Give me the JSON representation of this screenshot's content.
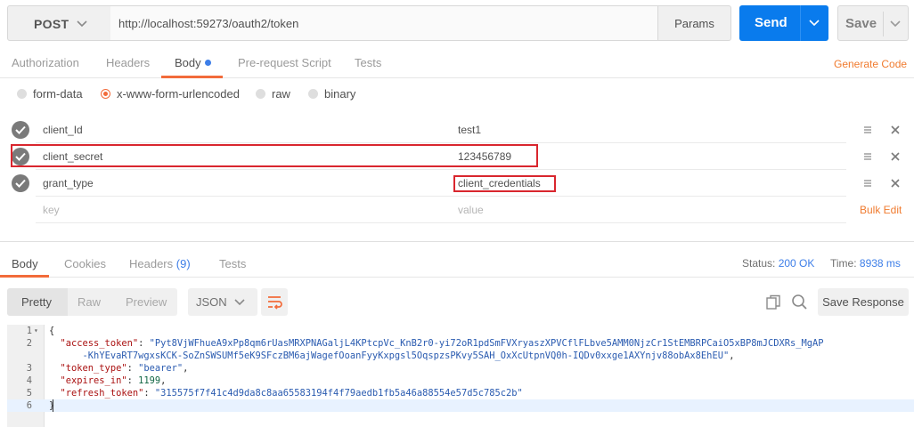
{
  "request": {
    "method": "POST",
    "url": "http://localhost:59273/oauth2/token",
    "params_label": "Params",
    "send_label": "Send",
    "save_label": "Save"
  },
  "request_tabs": [
    {
      "label": "Authorization",
      "active": false
    },
    {
      "label": "Headers",
      "active": false
    },
    {
      "label": "Body",
      "active": true
    },
    {
      "label": "Pre-request Script",
      "active": false
    },
    {
      "label": "Tests",
      "active": false
    }
  ],
  "generate_code_label": "Generate Code",
  "body_types": [
    {
      "label": "form-data",
      "selected": false
    },
    {
      "label": "x-www-form-urlencoded",
      "selected": true
    },
    {
      "label": "raw",
      "selected": false
    },
    {
      "label": "binary",
      "selected": false
    }
  ],
  "params": [
    {
      "key": "client_Id",
      "value": "test1",
      "enabled": true
    },
    {
      "key": "client_secret",
      "value": "123456789",
      "enabled": true
    },
    {
      "key": "grant_type",
      "value": "client_credentials",
      "enabled": true
    }
  ],
  "new_row": {
    "key_placeholder": "key",
    "value_placeholder": "value"
  },
  "bulk_edit_label": "Bulk Edit",
  "response_tabs": [
    {
      "label": "Body",
      "active": true
    },
    {
      "label": "Cookies",
      "active": false
    },
    {
      "label": "Headers",
      "count": "(9)",
      "active": false
    },
    {
      "label": "Tests",
      "active": false
    }
  ],
  "status": {
    "label": "Status:",
    "value": "200 OK",
    "time_label": "Time:",
    "time_value": "8938 ms"
  },
  "view_modes": [
    "Pretty",
    "Raw",
    "Preview"
  ],
  "format": "JSON",
  "save_response_label": "Save Response",
  "response_body": {
    "line_numbers": [
      "1",
      "2",
      "3",
      "4",
      "5",
      "6"
    ],
    "open_brace": "{",
    "close_brace": "}",
    "access_token_key": "\"access_token\"",
    "access_token_value_part1": "\"Pyt8VjWFhueA9xPp8qm6rUasMRXPNAGaljL4KPtcpVc_KnB2r0-yi72oR1pdSmFVXryaszXPVCflFLbve5AMM0NjzCr1StEMBRPCaiO5xBP8mJCDXRs_MgAP",
    "access_token_value_part2": "-KhYEvaRT7wgxsKCK-SoZnSWSUMf5eK9SFczBM6ajWagefOoanFyyKxpgsl5OqspzsPKvy5SAH_OxXcUtpnVQ0h-IQDv0xxge1AXYnjv88obAx8EhEU\"",
    "token_type_key": "\"token_type\"",
    "token_type_value": "\"bearer\"",
    "expires_in_key": "\"expires_in\"",
    "expires_in_value": "1199",
    "refresh_token_key": "\"refresh_token\"",
    "refresh_token_value": "\"315575f7f41c4d9da8c8aa65583194f4f79aedb1fb5a46a88554e57d5c785c2b\""
  },
  "colors": {
    "send_button": "#097bed",
    "accent_orange": "#f26b3a",
    "link_orange": "#f07b2f",
    "highlight_box": "#d9262e",
    "status_blue": "#3d7ee8"
  }
}
